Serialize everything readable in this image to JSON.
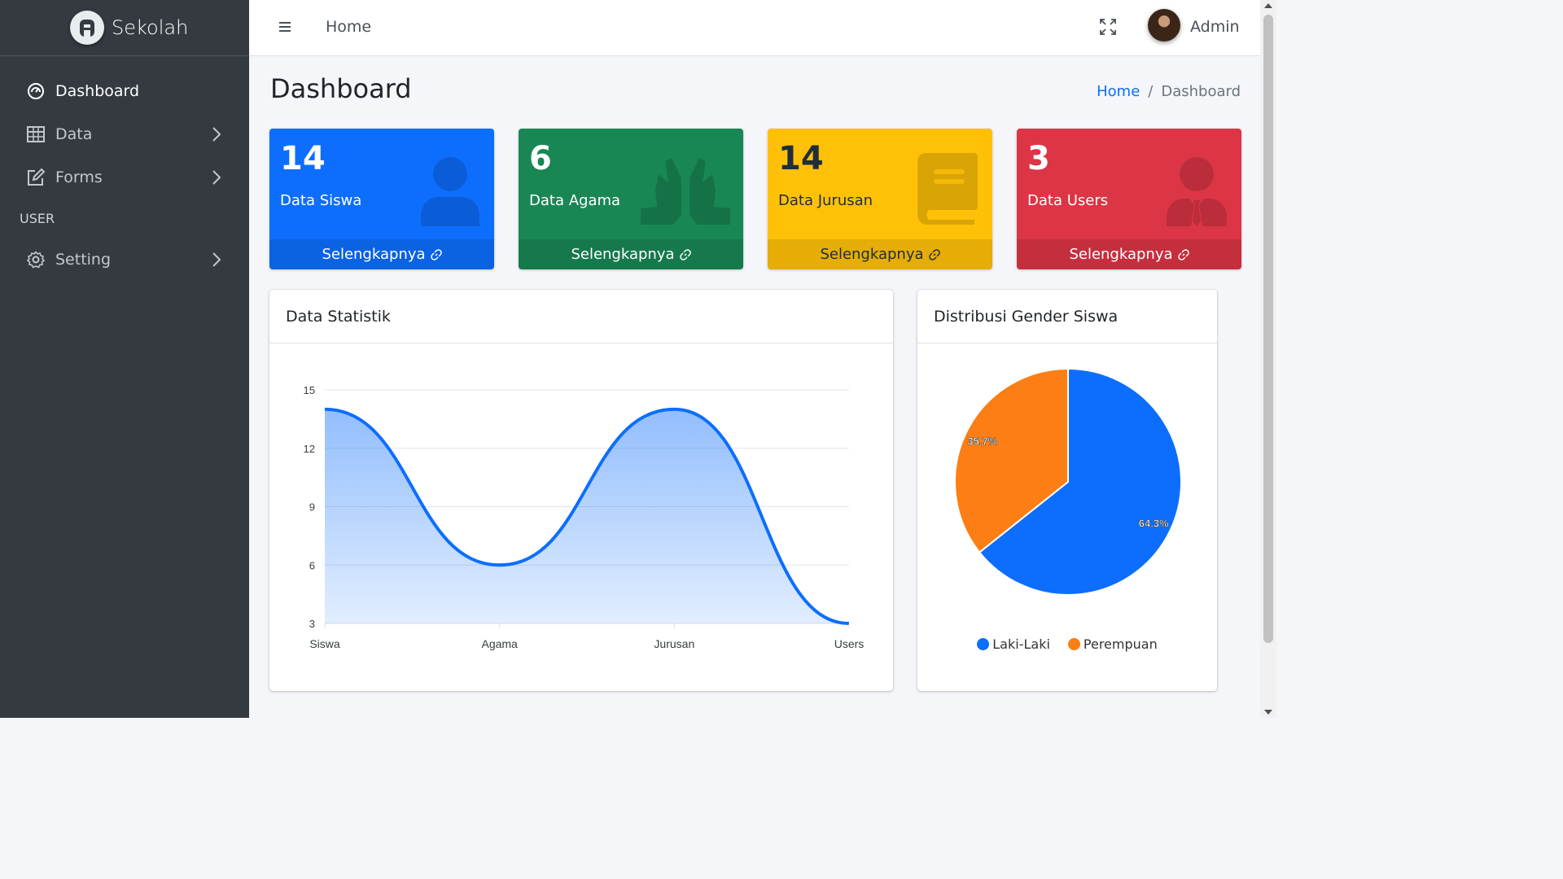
{
  "brand": {
    "name": "Sekolah"
  },
  "sidebar": {
    "items": [
      {
        "label": "Dashboard",
        "icon": "tachometer-icon",
        "active": true
      },
      {
        "label": "Data",
        "icon": "table-icon"
      },
      {
        "label": "Forms",
        "icon": "edit-icon"
      }
    ],
    "header": "USER",
    "setting": {
      "label": "Setting",
      "icon": "gear-icon"
    }
  },
  "topbar": {
    "home": "Home",
    "user": "Admin"
  },
  "content": {
    "title": "Dashboard",
    "breadcrumb": {
      "home": "Home",
      "current": "Dashboard"
    }
  },
  "boxes": [
    {
      "value": "14",
      "label": "Data Siswa",
      "more": "Selengkapnya",
      "color": "#0d6efd",
      "icon": "user-icon"
    },
    {
      "value": "6",
      "label": "Data Agama",
      "more": "Selengkapnya",
      "color": "#198754",
      "icon": "praying-hands-icon"
    },
    {
      "value": "14",
      "label": "Data Jurusan",
      "more": "Selengkapnya",
      "color": "#ffc107",
      "icon": "book-icon"
    },
    {
      "value": "3",
      "label": "Data Users",
      "more": "Selengkapnya",
      "color": "#dc3545",
      "icon": "user-tie-icon"
    }
  ],
  "cards": {
    "stat_title": "Data Statistik",
    "gender_title": "Distribusi Gender Siswa"
  },
  "chart_data": [
    {
      "type": "area",
      "title": "Data Statistik",
      "categories": [
        "Siswa",
        "Agama",
        "Jurusan",
        "Users"
      ],
      "values": [
        14,
        6,
        14,
        3
      ],
      "ylim": [
        3,
        15
      ],
      "yticks": [
        3,
        6,
        9,
        12,
        15
      ],
      "grid": true,
      "color": "#0d6efd",
      "smooth": true
    },
    {
      "type": "pie",
      "title": "Distribusi Gender Siswa",
      "labels": [
        "Laki-Laki",
        "Perempuan"
      ],
      "values": [
        64.3,
        35.7
      ],
      "value_labels": [
        "64.3%",
        "35.7%"
      ],
      "colors": [
        "#0d6efd",
        "#fd7e14"
      ],
      "legend": "bottom"
    }
  ]
}
